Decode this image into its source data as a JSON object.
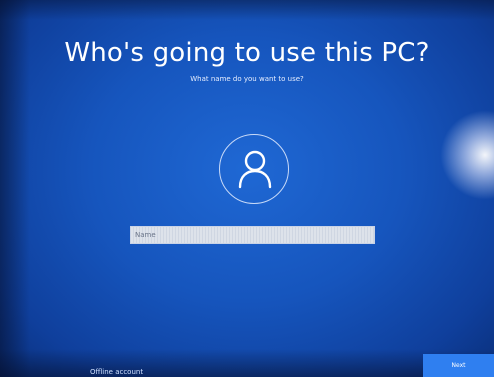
{
  "screen": {
    "title": "Who's going to use this PC?",
    "subtitle": "What name do you want to use?",
    "avatar_icon": "person-icon",
    "name_field": {
      "placeholder": "Name",
      "value": ""
    },
    "offline_link": "Offline account",
    "next_label": "Next"
  },
  "colors": {
    "background": "#1655bd",
    "accent_button": "#2f7ff0",
    "text": "#ffffff",
    "input_background": "#dde2ea"
  }
}
